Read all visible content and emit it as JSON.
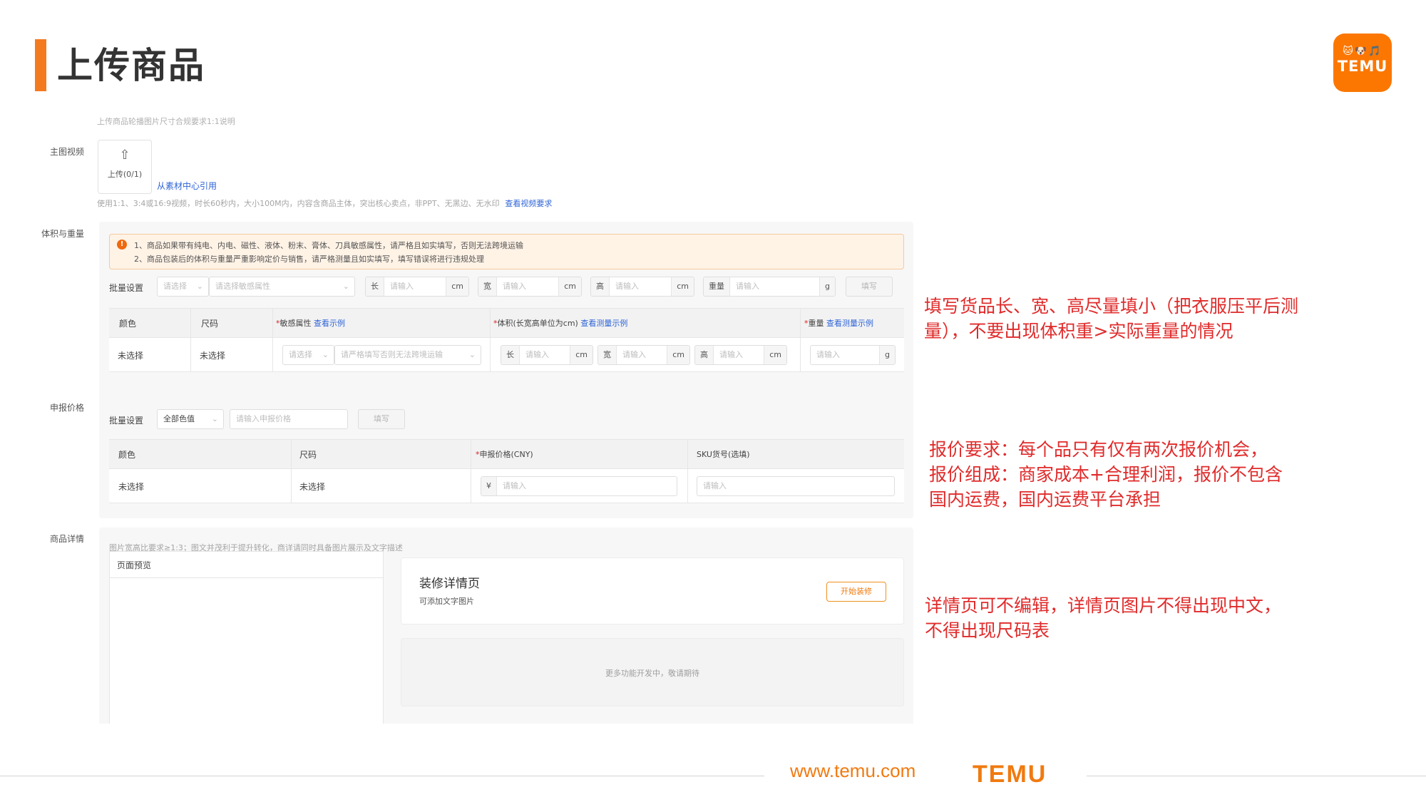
{
  "page": {
    "title": "上传商品"
  },
  "logo": {
    "pets": "🐱🐶🎵",
    "word": "TEMU"
  },
  "video": {
    "cut_text": "上传商品轮播图片尺寸合规要求1:1说明",
    "label": "主图视频",
    "upload_label": "上传(0/1)",
    "material_link": "从素材中心引用",
    "hint": "使用1:1、3:4或16:9视频，时长60秒内，大小100M内，内容含商品主体，突出核心卖点，非PPT、无黑边、无水印",
    "requirements_link": "查看视频要求"
  },
  "volume": {
    "label": "体积与重量",
    "warning_line1": "1、商品如果带有纯电、内电、磁性、液体、粉末、膏体、刀具敏感属性，请严格且如实填写，否则无法跨境运输",
    "warning_line2": "2、商品包装后的体积与重量严重影响定价与销售，请严格测量且如实填写，填写错误将进行违规处理",
    "batch_label": "批量设置",
    "select_placeholder": "请选择",
    "sensitive_placeholder": "请选择敏感属性",
    "length_label": "长",
    "width_label": "宽",
    "height_label": "高",
    "weight_label": "重量",
    "input_placeholder": "请输入",
    "unit_cm": "cm",
    "unit_g": "g",
    "fill_button": "填写",
    "columns": {
      "color": "颜色",
      "size": "尺码",
      "sensitive": "敏感属性",
      "sensitive_link": "查看示例",
      "volume": "体积(长宽高单位为cm)",
      "volume_link": "查看测量示例",
      "weight": "重量",
      "weight_link": "查看测量示例"
    },
    "row": {
      "color": "未选择",
      "size": "未选择",
      "sensitive_hint": "请严格填写否则无法跨境运输"
    }
  },
  "price": {
    "label": "申报价格",
    "batch_label": "批量设置",
    "all_colors": "全部色值",
    "price_placeholder": "请输入申报价格",
    "fill_button": "填写",
    "columns": {
      "color": "颜色",
      "size": "尺码",
      "declared_price": "申报价格(CNY)",
      "sku": "SKU货号(选填)"
    },
    "row": {
      "color": "未选择",
      "size": "未选择",
      "currency": "¥",
      "placeholder": "请输入"
    }
  },
  "detail": {
    "label": "商品详情",
    "hint": "图片宽高比要求≥1:3；图文并茂利于提升转化，商详请同时具备图片展示及文字描述",
    "preview_title": "页面预览",
    "decorate_title": "装修详情页",
    "decorate_sub": "可添加文字图片",
    "decorate_button": "开始装修",
    "more_text": "更多功能开发中，敬请期待"
  },
  "annotations": {
    "a1_line1": "填写货品长、宽、高尽量填小（把衣服压平后测",
    "a1_line2": "量），不要出现体积重>实际重量的情况",
    "a2_line1": "报价要求：每个品只有仅有两次报价机会，",
    "a2_line2": "报价组成：商家成本+合理利润，报价不包含",
    "a2_line3": "国内运费，国内运费平台承担",
    "a3_line1": "详情页可不编辑，详情页图片不得出现中文，",
    "a3_line2": "不得出现尺码表"
  },
  "footer": {
    "url": "www.temu.com",
    "logo": "TEMU"
  }
}
